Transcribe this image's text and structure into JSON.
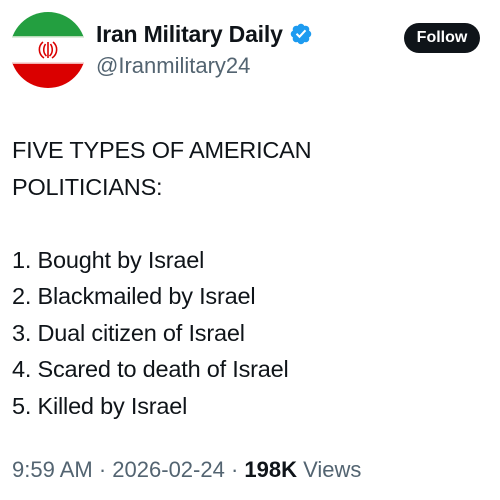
{
  "account": {
    "display_name": "Iran Military Daily",
    "handle": "@Iranmilitary24",
    "verified_icon": "verified-badge-icon",
    "avatar_icon": "iran-flag-avatar"
  },
  "follow_label": "Follow",
  "tweet": {
    "lines": [
      "FIVE TYPES OF AMERICAN",
      "POLITICIANS:",
      "",
      "1. Bought by Israel",
      "2. Blackmailed by Israel",
      "3. Dual citizen of Israel",
      "4. Scared to death of Israel",
      "5. Killed by Israel"
    ]
  },
  "meta": {
    "time": "9:59 AM",
    "separator": "·",
    "date": "2026-02-24",
    "views_count": "198K",
    "views_label": "Views"
  },
  "colors": {
    "verified_blue": "#1d9bf0",
    "flag_green": "#239f40",
    "flag_red": "#da0000",
    "secondary_text": "#536471",
    "primary_text": "#0f1419"
  }
}
